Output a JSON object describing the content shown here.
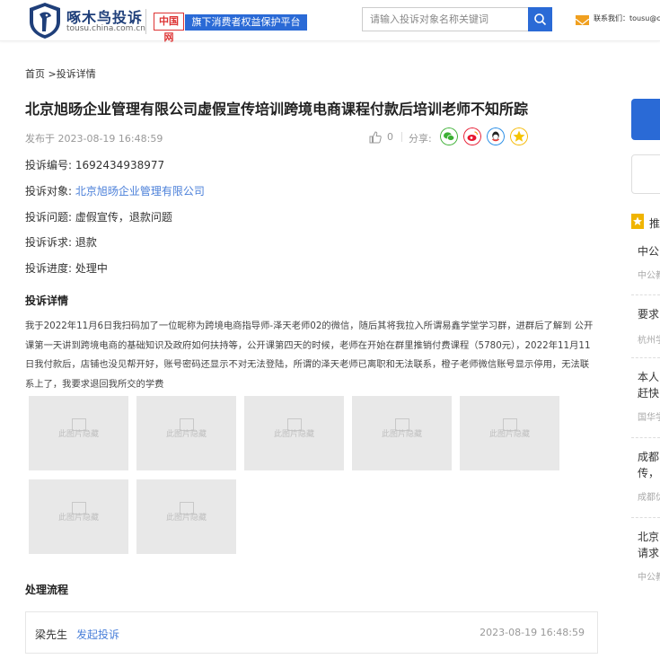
{
  "header": {
    "brand_name": "啄木鸟投诉",
    "brand_domain": "tousu.china.com.cn",
    "partner_logo": "中国网",
    "slogan": "旗下消费者权益保护平台",
    "search_placeholder": "请输入投诉对象名称关键词",
    "search_icon": "search-icon",
    "contact": "联系我们：tousu@c",
    "mail_icon": "mail-icon",
    "accent": "#2a6ad6"
  },
  "breadcrumb": {
    "home": "首页",
    "sep": " >",
    "current": "投诉详情"
  },
  "complaint": {
    "title": "北京旭旸企业管理有限公司虚假宣传培训跨境电商课程付款后培训老师不知所踪",
    "published": "发布于 2023-08-19 16:48:59",
    "likes": "0",
    "share_label": "分享:",
    "share_icons": [
      "wechat-icon",
      "weibo-icon",
      "qq-icon",
      "qzone-icon"
    ],
    "fields": [
      {
        "label": "投诉编号:",
        "value": "1692434938977",
        "link": false
      },
      {
        "label": "投诉对象:",
        "value": "北京旭旸企业管理有限公司",
        "link": true
      },
      {
        "label": "投诉问题:",
        "value": "虚假宣传，退款问题",
        "link": false
      },
      {
        "label": "投诉诉求:",
        "value": "退款",
        "link": false
      },
      {
        "label": "投诉进度:",
        "value": "处理中",
        "link": false
      }
    ]
  },
  "details": {
    "heading": "投诉详情",
    "text": "我于2022年11月6日我扫码加了一位昵称为跨境电商指导师-泽天老师02的微信，随后其将我拉入所谓易鑫学堂学习群，进群后了解到 公开课第一天讲到跨境电商的基础知识及政府如何扶持等，公开课第四天的时候，老师在开始在群里推销付费课程（5780元），2022年11月11日我付款后，店铺也没见帮开好，账号密码还显示不对无法登陆，所谓的泽天老师已离职和无法联系，橙子老师微信账号显示停用，无法联系上了，我要求退回我所交的学费",
    "image_placeholder": "此图片隐藏",
    "image_count": 7
  },
  "process": {
    "heading": "处理流程",
    "name": "梁先生",
    "action": "发起投诉",
    "time": "2023-08-19 16:48:59"
  },
  "sidebar": {
    "recommend_label": "推",
    "items": [
      {
        "title": "中公",
        "sub": "中公教"
      },
      {
        "title": "要求",
        "sub": "杭州学"
      },
      {
        "title": "本人\n赶快",
        "sub": "国华学"
      },
      {
        "title": "成都\n传，",
        "sub": "成都优"
      },
      {
        "title": "北京\n请求",
        "sub": "中公教"
      }
    ]
  }
}
